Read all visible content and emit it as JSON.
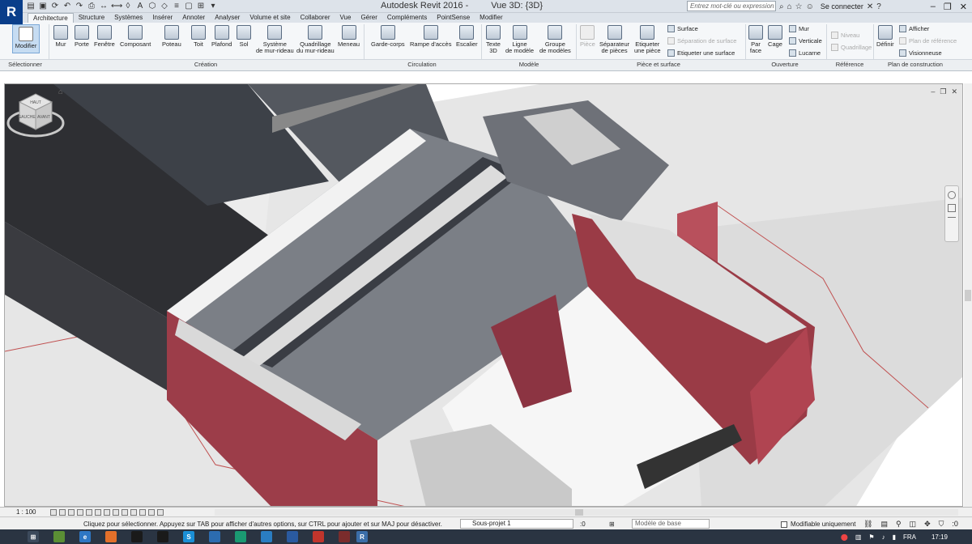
{
  "app": {
    "logo": "R",
    "title": "Autodesk Revit 2016 -",
    "view": "Vue 3D: {3D}"
  },
  "search": {
    "placeholder": "Entrez mot-clé ou expression"
  },
  "signin": "Se connecter",
  "tabs": [
    "Architecture",
    "Structure",
    "Systèmes",
    "Insérer",
    "Annoter",
    "Analyser",
    "Volume et site",
    "Collaborer",
    "Vue",
    "Gérer",
    "Compléments",
    "PointSense",
    "Modifier"
  ],
  "ribbon": {
    "select": {
      "modifier": "Modifier",
      "panel": "Sélectionner"
    },
    "creation": {
      "mur": "Mur",
      "porte": "Porte",
      "fenetre": "Fenêtre",
      "composant": "Composant",
      "poteau": "Poteau",
      "toit": "Toit",
      "plafond": "Plafond",
      "sol": "Sol",
      "systeme1": "Système",
      "systeme2": "de mur-rideau",
      "quadrillage1": "Quadrillage",
      "quadrillage2": "du mur-rideau",
      "meneau": "Meneau",
      "panel": "Création"
    },
    "circulation": {
      "gardecorps": "Garde-corps",
      "rampe": "Rampe d'accès",
      "escalier": "Escalier",
      "panel": "Circulation"
    },
    "modele": {
      "texte1": "Texte",
      "texte2": "3D",
      "ligne1": "Ligne",
      "ligne2": "de modèle",
      "groupe1": "Groupe",
      "groupe2": "de modèles",
      "panel": "Modèle"
    },
    "piece": {
      "piece": "Pièce",
      "sep1": "Séparateur",
      "sep2": "de pièces",
      "etq1": "Etiqueter",
      "etq2": "une pièce",
      "surface": "Surface",
      "sepsurface": "Séparation de surface",
      "etqsurface": "Etiqueter une surface",
      "panel": "Pièce et surface"
    },
    "ouverture": {
      "par1": "Par",
      "par2": "face",
      "cage": "Cage",
      "mur": "Mur",
      "verticale": "Verticale",
      "lucarne": "Lucarne",
      "panel": "Ouverture"
    },
    "reference": {
      "niveau": "Niveau",
      "quadrillage": "Quadrillage",
      "panel": "Référence"
    },
    "plan": {
      "definir": "Définir",
      "afficher": "Afficher",
      "planref": "Plan de référence",
      "visionneuse": "Visionneuse",
      "panel": "Plan de construction"
    }
  },
  "viewcube": {
    "top": "HAUT",
    "left": "GAUCHE",
    "front": "AVANT"
  },
  "viewbar": {
    "scale": "1 : 100"
  },
  "status": {
    "message": "Cliquez pour sélectionner. Appuyez sur TAB pour afficher d'autres options, sur CTRL pour ajouter et sur MAJ pour désactiver.",
    "workset": "Sous-projet 1",
    "ws_count": ":0",
    "design_option": "Modèle de base",
    "editable": "Modifiable uniquement",
    "filter_count": ":0"
  },
  "taskbar": {
    "lang": "FRA",
    "time": "17:19"
  },
  "colors": {
    "ribbon_bg": "#f5f7f9",
    "brick": "#a0434f",
    "roof": "#4a4e55",
    "taskbar": "#2a3442"
  }
}
